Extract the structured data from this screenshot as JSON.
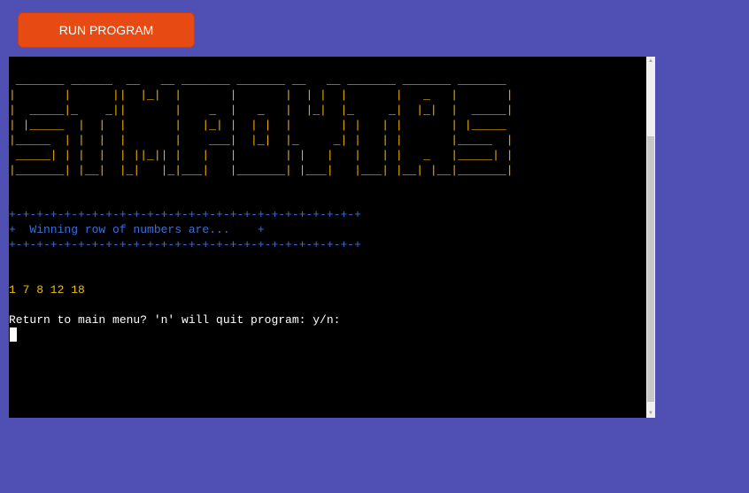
{
  "run_button": {
    "label": "RUN PROGRAM"
  },
  "terminal": {
    "ascii_art": " _______ ______  __   __ _______ _______ __   __ _______ _______ _______\n|       |      ||  |_|  |       |       |  | |  |       |   _   |       |\n|  _____|_    _||       |    _  |   _   |  |_|  |_     _|  |_|  |  _____|\n| |_____  |  |  |       |   |_| |  | |  |       | |   | |       | |_____\n|_____  | |  |  |       |    ___|  |_|  |_     _| |   | |       |_____  |\n _____| | |  |  | ||_|| |   |   |       | |   |   |   | |   _   |_____| |\n|_______| |__|  |_|   |_|___|   |_______| |___|   |___| |__| |__|_______|",
    "banner_top": "+-+-+-+-+-+-+-+-+-+-+-+-+-+-+-+-+-+-+-+-+-+-+-+-+-+",
    "banner_text": "+  Winning row of numbers are...    +",
    "banner_bottom": "+-+-+-+-+-+-+-+-+-+-+-+-+-+-+-+-+-+-+-+-+-+-+-+-+-+",
    "numbers": "1 7 8 12 18",
    "prompt": "Return to main menu? 'n' will quit program: y/n:"
  },
  "colors": {
    "background": "#5050b4",
    "button": "#e84a14",
    "art": "#f0b000",
    "banner": "#3b6fd8",
    "numbers": "#f0c000"
  }
}
